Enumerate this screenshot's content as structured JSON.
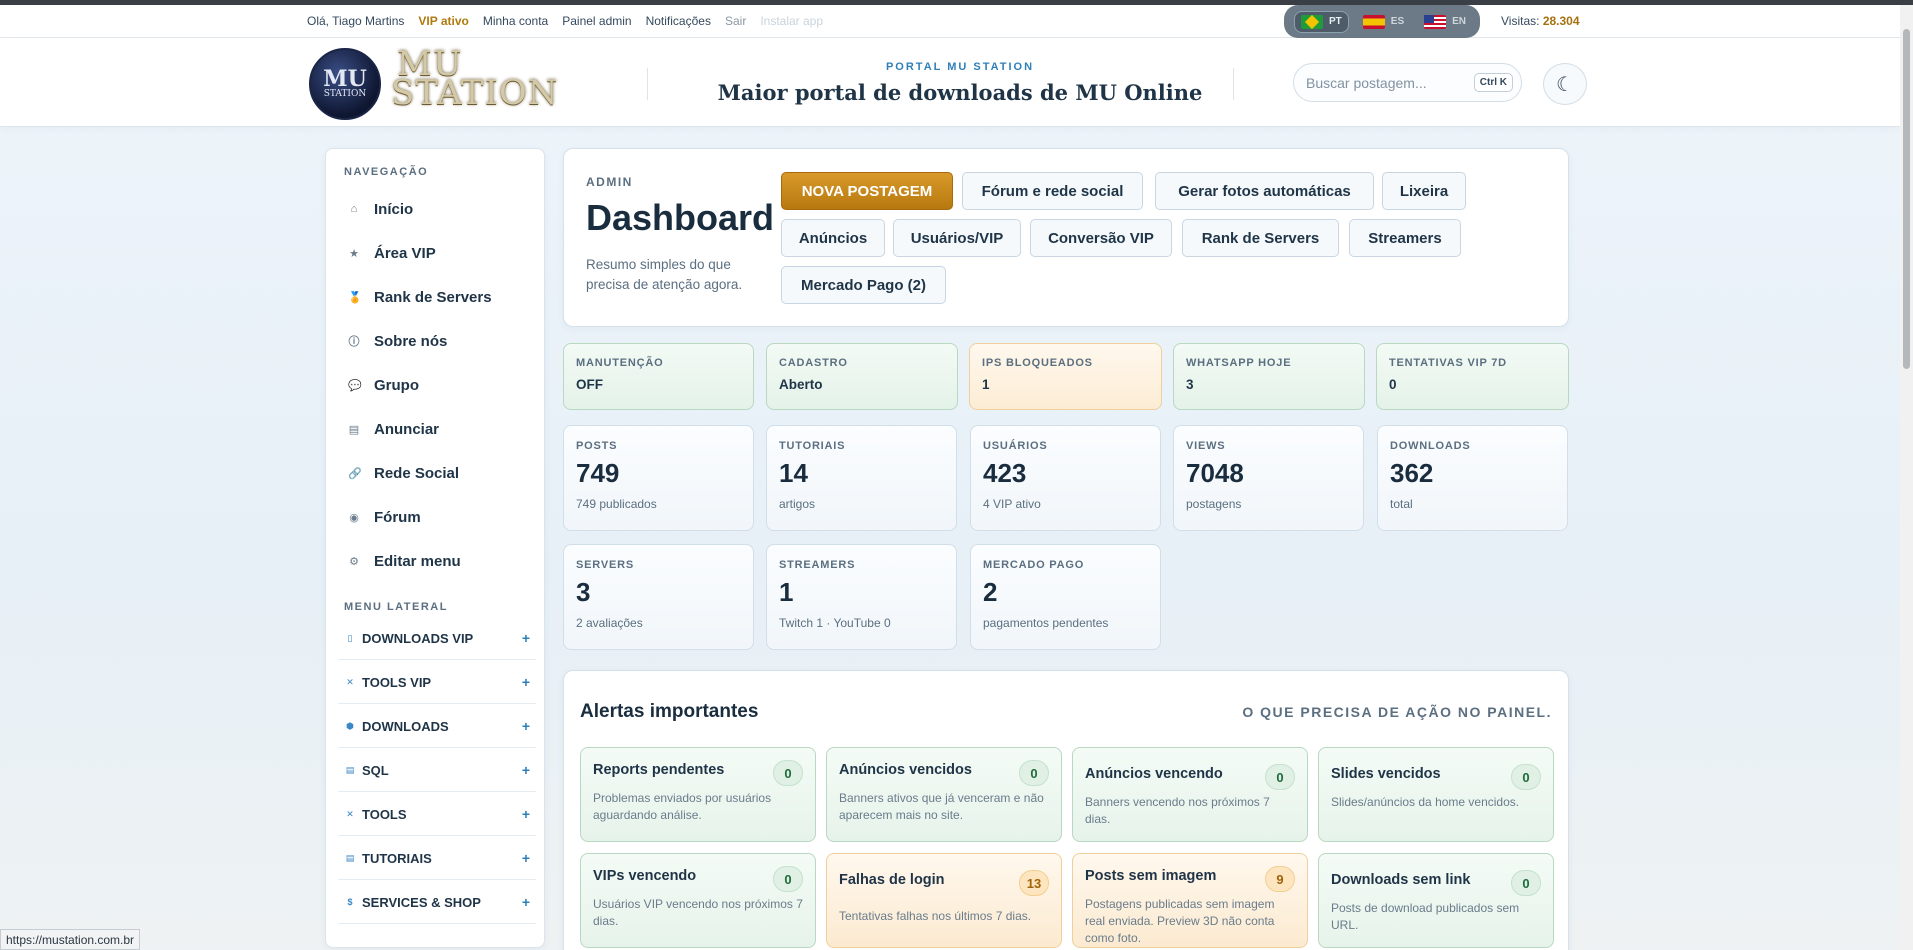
{
  "topbar": {
    "greeting": "Olá, Tiago Martins",
    "vip": "VIP ativo",
    "my_account": "Minha conta",
    "admin_panel": "Painel admin",
    "notifications": "Notificações",
    "logout": "Sair",
    "install_app": "Instalar app",
    "langs": [
      {
        "code": "PT",
        "flag": "br-flag-icon",
        "active": true
      },
      {
        "code": "ES",
        "flag": "es-flag-icon",
        "active": false
      },
      {
        "code": "EN",
        "flag": "us-flag-icon",
        "active": false
      }
    ],
    "visits_label": "Visitas:",
    "visits_value": "28.304"
  },
  "header": {
    "logo_mark_1": "MU",
    "logo_mark_2": "STATION",
    "logo_text_1": "MU",
    "logo_text_2": "STATION",
    "portal_label": "PORTAL MU STATION",
    "tagline": "Maior portal de downloads de MU Online",
    "search_placeholder": "Buscar postagem...",
    "search_shortcut": "Ctrl K",
    "theme_icon": "☾"
  },
  "sidebar": {
    "nav_title": "NAVEGAÇÃO",
    "nav_items": [
      {
        "label": "Início",
        "icon": "⌂",
        "icon_name": "home-icon"
      },
      {
        "label": "Área VIP",
        "icon": "★",
        "icon_name": "star-icon"
      },
      {
        "label": "Rank de Servers",
        "icon": "🏅",
        "icon_name": "medal-icon"
      },
      {
        "label": "Sobre nós",
        "icon": "ⓘ",
        "icon_name": "info-icon"
      },
      {
        "label": "Grupo",
        "icon": "💬",
        "icon_name": "chat-icon"
      },
      {
        "label": "Anunciar",
        "icon": "▤",
        "icon_name": "ad-icon"
      },
      {
        "label": "Rede Social",
        "icon": "🔗",
        "icon_name": "link-icon"
      },
      {
        "label": "Fórum",
        "icon": "◉",
        "icon_name": "forum-icon"
      },
      {
        "label": "Editar menu",
        "icon": "⚙",
        "icon_name": "gear-icon"
      }
    ],
    "menu_title": "MENU LATERAL",
    "menu_items": [
      {
        "label": "DOWNLOADS VIP",
        "icon": "▯",
        "icon_name": "vip-download-icon"
      },
      {
        "label": "TOOLS VIP",
        "icon": "✕",
        "icon_name": "tools-icon"
      },
      {
        "label": "DOWNLOADS",
        "icon": "⬢",
        "icon_name": "download-icon"
      },
      {
        "label": "SQL",
        "icon": "▤",
        "icon_name": "database-icon"
      },
      {
        "label": "TOOLS",
        "icon": "✕",
        "icon_name": "tools-icon"
      },
      {
        "label": "TUTORIAIS",
        "icon": "▤",
        "icon_name": "book-icon"
      },
      {
        "label": "SERVICES & SHOP",
        "icon": "$",
        "icon_name": "dollar-icon"
      }
    ],
    "expand_symbol": "+"
  },
  "admin": {
    "label": "ADMIN",
    "title": "Dashboard",
    "subtitle": "Resumo simples do que precisa de atenção agora.",
    "buttons": [
      {
        "label": "NOVA POSTAGEM",
        "primary": true
      },
      {
        "label": "Fórum e rede social"
      },
      {
        "label": "Gerar fotos automáticas"
      },
      {
        "label": "Lixeira"
      },
      {
        "label": "Anúncios"
      },
      {
        "label": "Usuários/VIP"
      },
      {
        "label": "Conversão VIP"
      },
      {
        "label": "Rank de Servers"
      },
      {
        "label": "Streamers"
      },
      {
        "label": "Mercado Pago (2)"
      }
    ]
  },
  "status": [
    {
      "key": "MANUTENÇÃO",
      "value": "OFF",
      "tone": "ok"
    },
    {
      "key": "CADASTRO",
      "value": "Aberto",
      "tone": "ok"
    },
    {
      "key": "IPS BLOQUEADOS",
      "value": "1",
      "tone": "warn"
    },
    {
      "key": "WHATSAPP HOJE",
      "value": "3",
      "tone": "ok"
    },
    {
      "key": "TENTATIVAS VIP 7D",
      "value": "0",
      "tone": "ok"
    }
  ],
  "metrics": [
    {
      "key": "POSTS",
      "value": "749",
      "sub": "749 publicados"
    },
    {
      "key": "TUTORIAIS",
      "value": "14",
      "sub": "artigos"
    },
    {
      "key": "USUÁRIOS",
      "value": "423",
      "sub": "4 VIP ativo"
    },
    {
      "key": "VIEWS",
      "value": "7048",
      "sub": "postagens"
    },
    {
      "key": "DOWNLOADS",
      "value": "362",
      "sub": "total"
    },
    {
      "key": "SERVERS",
      "value": "3",
      "sub": "2 avaliações"
    },
    {
      "key": "STREAMERS",
      "value": "1",
      "sub": "Twitch 1 · YouTube 0"
    },
    {
      "key": "MERCADO PAGO",
      "value": "2",
      "sub": "pagamentos pendentes"
    }
  ],
  "alerts": {
    "title": "Alertas importantes",
    "subtitle": "O QUE PRECISA DE AÇÃO NO PAINEL.",
    "items": [
      {
        "title": "Reports pendentes",
        "count": "0",
        "desc": "Problemas enviados por usuários aguardando análise.",
        "tone": "ok"
      },
      {
        "title": "Anúncios vencidos",
        "count": "0",
        "desc": "Banners ativos que já venceram e não aparecem mais no site.",
        "tone": "ok"
      },
      {
        "title": "Anúncios vencendo",
        "count": "0",
        "desc": "Banners vencendo nos próximos 7 dias.",
        "tone": "ok"
      },
      {
        "title": "Slides vencidos",
        "count": "0",
        "desc": "Slides/anúncios da home vencidos.",
        "tone": "ok"
      },
      {
        "title": "VIPs vencendo",
        "count": "0",
        "desc": "Usuários VIP vencendo nos próximos 7 dias.",
        "tone": "ok"
      },
      {
        "title": "Falhas de login",
        "count": "13",
        "desc": "Tentativas falhas nos últimos 7 dias.",
        "tone": "warn"
      },
      {
        "title": "Posts sem imagem",
        "count": "9",
        "desc": "Postagens publicadas sem imagem real enviada. Preview 3D não conta como foto.",
        "tone": "warn"
      },
      {
        "title": "Downloads sem link",
        "count": "0",
        "desc": "Posts de download publicados sem URL.",
        "tone": "ok"
      }
    ]
  },
  "statusbar": {
    "url": "https://mustation.com.br"
  }
}
